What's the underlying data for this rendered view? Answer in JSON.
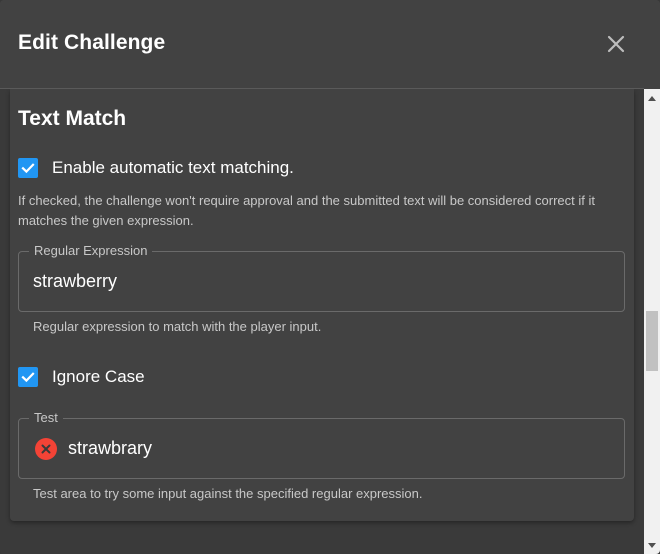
{
  "dialog": {
    "title": "Edit Challenge",
    "close_icon": "close-icon"
  },
  "section": {
    "title": "Text Match"
  },
  "auto_match": {
    "label": "Enable automatic text matching.",
    "checked": true,
    "help": "If checked, the challenge won't require approval and the submitted text will be considered correct if it matches the given expression."
  },
  "regex_field": {
    "label": "Regular Expression",
    "value": "strawberry",
    "help": "Regular expression to match with the player input."
  },
  "ignore_case": {
    "label": "Ignore Case",
    "checked": true
  },
  "test_field": {
    "label": "Test",
    "value": "strawbrary",
    "status_icon": "error-circle-icon",
    "help": "Test area to try some input against the specified regular expression."
  },
  "colors": {
    "dialog_bg": "#424242",
    "checkbox": "#2196f3",
    "error": "#f44336"
  }
}
